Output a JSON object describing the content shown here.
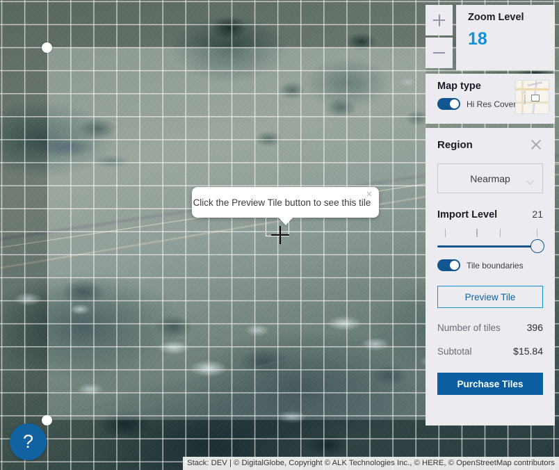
{
  "map": {
    "attribution": "Stack: DEV | © DigitalGlobe, Copyright © ALK Technologies Inc., © HERE, © OpenStreetMap contributors",
    "help_label": "?",
    "tooltip": {
      "text": "Click the Preview Tile button to see this tile",
      "close_label": "×"
    }
  },
  "zoom_panel": {
    "zoom_in_label": "+",
    "zoom_out_label": "−",
    "title": "Zoom Level",
    "value": "18"
  },
  "map_type": {
    "title": "Map type",
    "toggle_label": "Hi Res Coverage",
    "toggle_on": true,
    "thumbnail_name": "map-thumbnail",
    "thumb_street_1": "Eastern Rd",
    "thumb_street_2": "Hobson St"
  },
  "region": {
    "title": "Region",
    "close_label": "×",
    "source_select": {
      "value": "Nearmap"
    },
    "import_level": {
      "label": "Import Level",
      "value": "21",
      "tick_count": 4,
      "slider_position_pct": 100
    },
    "tile_boundaries": {
      "label": "Tile boundaries",
      "toggle_on": true
    },
    "preview_button_label": "Preview Tile",
    "summary": [
      {
        "label": "Number of tiles",
        "value": "396"
      },
      {
        "label": "Subtotal",
        "value": "$15.84"
      }
    ],
    "purchase_button_label": "Purchase Tiles"
  },
  "colors": {
    "accent_blue": "#1291d8",
    "brand_blue": "#0b5fa0",
    "panel_bg": "#ebebf0",
    "toggle_on": "#12558f"
  }
}
